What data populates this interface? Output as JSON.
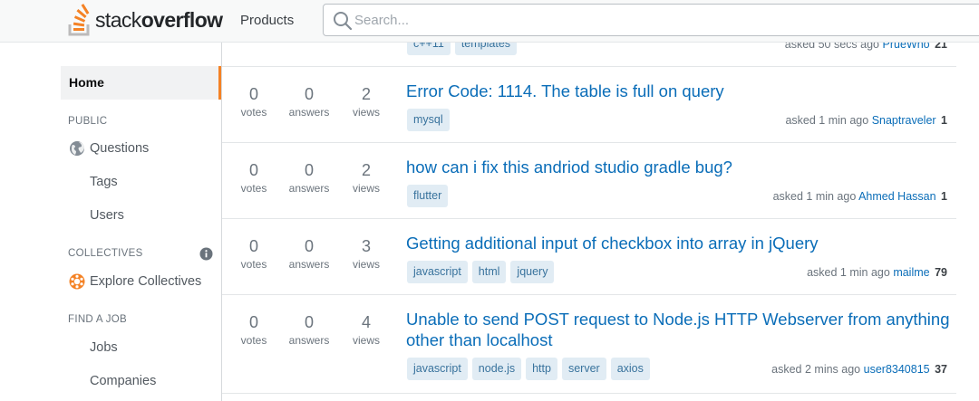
{
  "header": {
    "logo_text_light": "stack",
    "logo_text_bold": "overflow",
    "products_label": "Products",
    "search_placeholder": "Search..."
  },
  "sidebar": {
    "home_label": "Home",
    "public_heading": "PUBLIC",
    "questions_label": "Questions",
    "tags_label": "Tags",
    "users_label": "Users",
    "collectives_heading": "COLLECTIVES",
    "explore_collectives_label": "Explore Collectives",
    "find_job_heading": "FIND A JOB",
    "jobs_label": "Jobs",
    "companies_label": "Companies"
  },
  "questions": [
    {
      "votes": "",
      "answers": "",
      "views": "",
      "title": "",
      "tags": [
        "c++11",
        "templates"
      ],
      "asked": "asked 50 secs ago",
      "user": "PrueWho",
      "rep": "21"
    },
    {
      "votes": "0",
      "answers": "0",
      "views": "2",
      "title": "Error Code: 1114. The table is full on query",
      "tags": [
        "mysql"
      ],
      "asked": "asked 1 min ago",
      "user": "Snaptraveler",
      "rep": "1"
    },
    {
      "votes": "0",
      "answers": "0",
      "views": "2",
      "title": "how can i fix this andriod studio gradle bug?",
      "tags": [
        "flutter"
      ],
      "asked": "asked 1 min ago",
      "user": "Ahmed Hassan",
      "rep": "1"
    },
    {
      "votes": "0",
      "answers": "0",
      "views": "3",
      "title": "Getting additional input of checkbox into array in jQuery",
      "tags": [
        "javascript",
        "html",
        "jquery"
      ],
      "asked": "asked 1 min ago",
      "user": "mailme",
      "rep": "79"
    },
    {
      "votes": "0",
      "answers": "0",
      "views": "4",
      "title": "Unable to send POST request to Node.js HTTP Webserver from anything other than localhost",
      "tags": [
        "javascript",
        "node.js",
        "http",
        "server",
        "axios"
      ],
      "asked": "asked 2 mins ago",
      "user": "user8340815",
      "rep": "37"
    }
  ],
  "labels": {
    "votes": "votes",
    "answers": "answers",
    "views": "views"
  },
  "colors": {
    "accent": "#f48225",
    "link": "#0a6db8",
    "tag_bg": "#e1ecf4",
    "tag_text": "#39739d"
  },
  "icons": [
    "stackoverflow-logo-icon",
    "search-icon",
    "globe-icon",
    "collectives-icon",
    "info-icon"
  ]
}
